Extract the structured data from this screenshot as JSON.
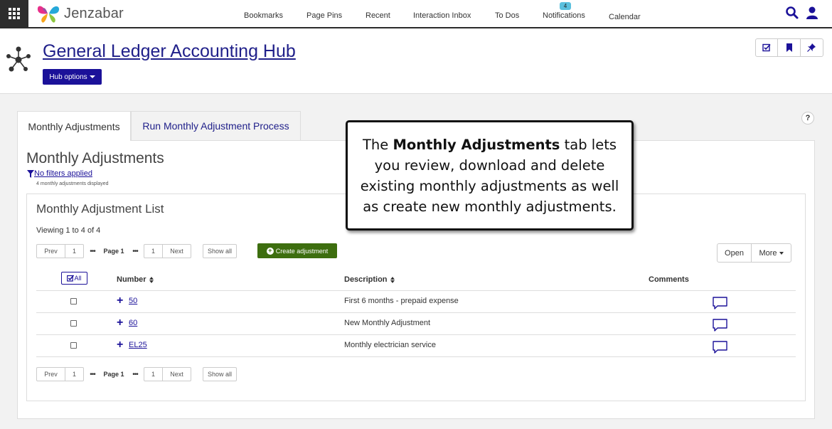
{
  "brand": {
    "name": "Jenzabar"
  },
  "nav": {
    "items": [
      "Bookmarks",
      "Page Pins",
      "Recent",
      "Interaction Inbox",
      "To Dos",
      "Notifications",
      "Calendar"
    ],
    "notification_count": "4"
  },
  "header": {
    "title": "General Ledger Accounting Hub",
    "hub_options_label": "Hub options"
  },
  "tabs": [
    {
      "label": "Monthly Adjustments",
      "active": true
    },
    {
      "label": "Run Monthly Adjustment Process",
      "active": false
    }
  ],
  "help_label": "?",
  "section": {
    "title": "Monthly Adjustments",
    "filter_label": "No filters applied",
    "count_text": "4 monthly adjustments displayed"
  },
  "list": {
    "title": "Monthly Adjustment List",
    "viewing": "Viewing 1 to 4 of 4",
    "pager": {
      "prev": "Prev",
      "first_page": "1",
      "ellipsis": "•••",
      "current": "Page 1",
      "last_page": "1",
      "next": "Next",
      "show_all": "Show all"
    },
    "create_label": "Create adjustment",
    "open_label": "Open",
    "more_label": "More",
    "all_label": "All",
    "columns": {
      "number": "Number",
      "description": "Description",
      "comments": "Comments"
    },
    "rows": [
      {
        "number": "50",
        "description": "First 6 months - prepaid expense"
      },
      {
        "number": "60",
        "description": "New Monthly Adjustment"
      },
      {
        "number": "EL25",
        "description": "Monthly electrician service"
      }
    ]
  },
  "callout": {
    "pre": "The ",
    "bold": "Monthly Adjustments",
    "post": " tab lets you review, download and delete existing monthly adjustments as well as create new monthly adjustments."
  },
  "colors": {
    "primary": "#1b1199",
    "create": "#3d6e0f",
    "badge": "#5bc0de",
    "topbar_dark": "#2d2d2d"
  },
  "icons": [
    "apps-grid-icon",
    "butterfly-logo-icon",
    "search-icon",
    "user-icon",
    "hub-network-icon",
    "checklist-icon",
    "bookmark-icon",
    "pin-icon",
    "filter-icon",
    "plus-circle-icon",
    "check-all-icon",
    "sort-icon",
    "expand-plus-icon",
    "comment-icon"
  ]
}
